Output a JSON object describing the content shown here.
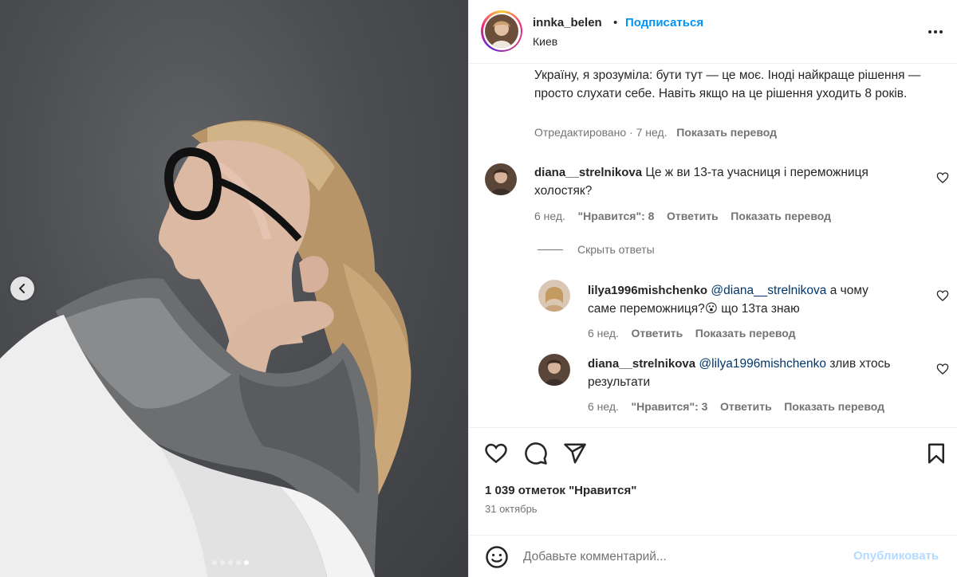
{
  "post": {
    "author": "innka_belen",
    "separator": "•",
    "follow_label": "Подписаться",
    "location": "Киев",
    "carousel": {
      "total": 5,
      "active_index": 4
    },
    "caption": {
      "text": "Україну, я зрозуміла: бути тут — це моє. Іноді найкраще рішення — просто слухати себе. Навіть якщо на це рішення уходить 8 років.",
      "edited": "Отредактировано · 7 нед.",
      "translate": "Показать перевод"
    },
    "comments": [
      {
        "author": "diana__strelnikova",
        "text": "Це ж ви 13-та учасниця і переможниця холостяк?",
        "age": "6 нед.",
        "likes": "\"Нравится\": 8",
        "reply": "Ответить",
        "translate": "Показать перевод"
      }
    ],
    "hide_replies": "Скрыть ответы",
    "replies": [
      {
        "author": "lilya1996mishchenko",
        "mention": "@diana__strelnikova",
        "text_line1": "а чому",
        "text_line2_prefix": "саме переможниця?",
        "emoji": "😮",
        "text_line2_suffix": "що 13та знаю",
        "age": "6 нед.",
        "reply": "Ответить",
        "translate": "Показать перевод"
      },
      {
        "author": "diana__strelnikova",
        "mention": "@lilya1996mishchenko",
        "text_line1": "злив хтось",
        "text_line2": "результати",
        "age": "6 нед.",
        "likes": "\"Нравится\": 3",
        "reply": "Ответить",
        "translate": "Показать перевод"
      }
    ],
    "likes_count": "1 039 отметок \"Нравится\"",
    "date": "31 октябрь",
    "add_comment": {
      "placeholder": "Добавьте комментарий...",
      "publish_label": "Опубликовать"
    },
    "icons": [
      "chevron-left-icon",
      "more-icon",
      "heart-icon",
      "comment-icon",
      "share-icon",
      "bookmark-icon",
      "emoji-icon"
    ],
    "colors": {
      "link": "#0095f6",
      "muted": "#737373",
      "publish_disabled": "#b3dbff",
      "mention": "#00376b"
    }
  }
}
